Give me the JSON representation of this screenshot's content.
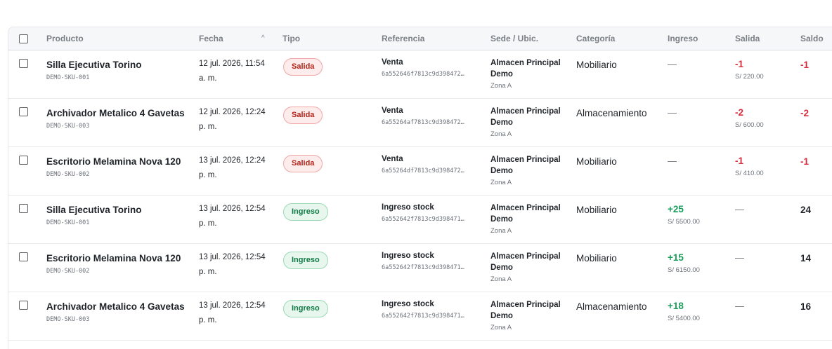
{
  "table": {
    "headers": {
      "producto": "Producto",
      "fecha": "Fecha",
      "tipo": "Tipo",
      "referencia": "Referencia",
      "sede": "Sede / Ubic.",
      "categoria": "Categoría",
      "ingreso": "Ingreso",
      "salida": "Salida",
      "saldo": "Saldo"
    },
    "sort_icon": "^",
    "rows": [
      {
        "producto": "Silla Ejecutiva Torino",
        "sku": "DEMO-SKU-001",
        "fecha_1": "12 jul. 2026, 11:54",
        "fecha_2": "a. m.",
        "tipo": "Salida",
        "tipo_kind": "salida",
        "ref": "Venta",
        "ref_hash": "6a552646f7813c9d398472…",
        "sede_1": "Almacen Principal",
        "sede_2": "Demo",
        "zona": "Zona A",
        "categoria": "Mobiliario",
        "ingreso": "—",
        "ingreso_money": "",
        "salida": "-1",
        "salida_money": "S/ 220.00",
        "saldo": "-1",
        "saldo_kind": "neg"
      },
      {
        "producto": "Archivador Metalico 4 Gavetas",
        "sku": "DEMO-SKU-003",
        "fecha_1": "12 jul. 2026, 12:24",
        "fecha_2": "p. m.",
        "tipo": "Salida",
        "tipo_kind": "salida",
        "ref": "Venta",
        "ref_hash": "6a55264af7813c9d398472…",
        "sede_1": "Almacen Principal",
        "sede_2": "Demo",
        "zona": "Zona A",
        "categoria": "Almacenamiento",
        "ingreso": "—",
        "ingreso_money": "",
        "salida": "-2",
        "salida_money": "S/ 600.00",
        "saldo": "-2",
        "saldo_kind": "neg"
      },
      {
        "producto": "Escritorio Melamina Nova 120",
        "sku": "DEMO-SKU-002",
        "fecha_1": "13 jul. 2026, 12:24",
        "fecha_2": "p. m.",
        "tipo": "Salida",
        "tipo_kind": "salida",
        "ref": "Venta",
        "ref_hash": "6a55264df7813c9d398472…",
        "sede_1": "Almacen Principal",
        "sede_2": "Demo",
        "zona": "Zona A",
        "categoria": "Mobiliario",
        "ingreso": "—",
        "ingreso_money": "",
        "salida": "-1",
        "salida_money": "S/ 410.00",
        "saldo": "-1",
        "saldo_kind": "neg"
      },
      {
        "producto": "Silla Ejecutiva Torino",
        "sku": "DEMO-SKU-001",
        "fecha_1": "13 jul. 2026, 12:54",
        "fecha_2": "p. m.",
        "tipo": "Ingreso",
        "tipo_kind": "ingreso",
        "ref": "Ingreso stock",
        "ref_hash": "6a552642f7813c9d398471…",
        "sede_1": "Almacen Principal",
        "sede_2": "Demo",
        "zona": "Zona A",
        "categoria": "Mobiliario",
        "ingreso": "+25",
        "ingreso_money": "S/ 5500.00",
        "salida": "—",
        "salida_money": "",
        "saldo": "24",
        "saldo_kind": "pos"
      },
      {
        "producto": "Escritorio Melamina Nova 120",
        "sku": "DEMO-SKU-002",
        "fecha_1": "13 jul. 2026, 12:54",
        "fecha_2": "p. m.",
        "tipo": "Ingreso",
        "tipo_kind": "ingreso",
        "ref": "Ingreso stock",
        "ref_hash": "6a552642f7813c9d398471…",
        "sede_1": "Almacen Principal",
        "sede_2": "Demo",
        "zona": "Zona A",
        "categoria": "Mobiliario",
        "ingreso": "+15",
        "ingreso_money": "S/ 6150.00",
        "salida": "—",
        "salida_money": "",
        "saldo": "14",
        "saldo_kind": "pos"
      },
      {
        "producto": "Archivador Metalico 4 Gavetas",
        "sku": "DEMO-SKU-003",
        "fecha_1": "13 jul. 2026, 12:54",
        "fecha_2": "p. m.",
        "tipo": "Ingreso",
        "tipo_kind": "ingreso",
        "ref": "Ingreso stock",
        "ref_hash": "6a552642f7813c9d398471…",
        "sede_1": "Almacen Principal",
        "sede_2": "Demo",
        "zona": "Zona A",
        "categoria": "Almacenamiento",
        "ingreso": "+18",
        "ingreso_money": "S/ 5400.00",
        "salida": "—",
        "salida_money": "",
        "saldo": "16",
        "saldo_kind": "pos"
      }
    ]
  },
  "colors": {
    "salida_text": "#b42318",
    "ingreso_text": "#0f7a45",
    "negative": "#d92d3f",
    "positive": "#1a9e5c",
    "header_bg": "#f6f7f8"
  }
}
